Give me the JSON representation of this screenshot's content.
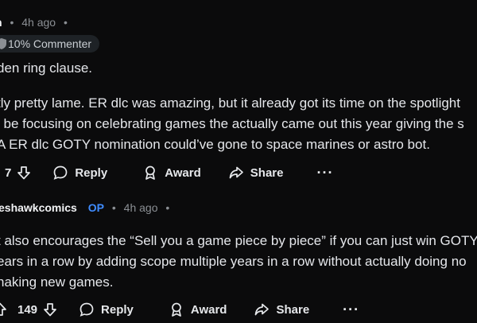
{
  "comment1": {
    "username_fragment": "n",
    "time": "4h ago",
    "badge": "10% Commenter",
    "lines": [
      "den ring clause.",
      "tly pretty lame. ER dlc was amazing, but it already got its time on the spotlight",
      "l be focusing on celebrating games the actually came out this year giving the s",
      "A ER dlc GOTY nomination could’ve gone to space marines or astro bot."
    ],
    "actions": {
      "vote_count": "7",
      "reply": "Reply",
      "award": "Award",
      "share": "Share",
      "more": "···"
    }
  },
  "comment2": {
    "username": "eshawkcomics",
    "op_label": "OP",
    "time": "4h ago",
    "lines": [
      "t also encourages the “Sell you a game piece by piece” if you can just win GOTY",
      "ears in a row by adding scope multiple years in a row without actually doing no",
      "naking new games."
    ],
    "actions": {
      "vote_count": "149",
      "reply": "Reply",
      "award": "Award",
      "share": "Share",
      "more": "···"
    }
  },
  "colors": {
    "background": "#0b0b0c",
    "op_blue": "#3f8cff",
    "badge_bg": "#1e2226"
  },
  "icons": [
    "shield-icon",
    "upvote-icon",
    "downvote-icon",
    "comment-icon",
    "award-icon",
    "share-icon",
    "more-icon",
    "dot-icon"
  ]
}
